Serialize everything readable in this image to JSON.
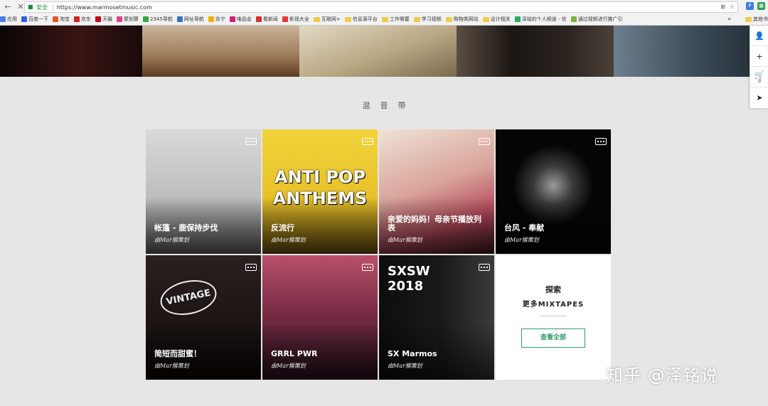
{
  "browser": {
    "back": "←",
    "reload": "✕",
    "secure_label": "安全",
    "url": "https://www.marmosetmusic.com",
    "bookmarks": [
      {
        "label": "应用",
        "color": "#4a7ee0",
        "folder": false
      },
      {
        "label": "百度一下",
        "color": "#2f61d6",
        "folder": false
      },
      {
        "label": "淘宝",
        "color": "#e25822",
        "folder": false
      },
      {
        "label": "京东",
        "color": "#d0261d",
        "folder": false
      },
      {
        "label": "天猫",
        "color": "#c40018",
        "folder": false
      },
      {
        "label": "聚划算",
        "color": "#e04080",
        "folder": false
      },
      {
        "label": "2345导航",
        "color": "#37a83c",
        "folder": false
      },
      {
        "label": "网址导航",
        "color": "#3572c9",
        "folder": false
      },
      {
        "label": "苏宁",
        "color": "#f2b200",
        "folder": false
      },
      {
        "label": "唯品会",
        "color": "#d91e77",
        "folder": false
      },
      {
        "label": "看新闻",
        "color": "#d32f2f",
        "folder": false
      },
      {
        "label": "影视大全",
        "color": "#e53935",
        "folder": false
      },
      {
        "label": "互联网+",
        "color": "",
        "folder": true
      },
      {
        "label": "信息源平台",
        "color": "",
        "folder": true
      },
      {
        "label": "工作需要",
        "color": "",
        "folder": true
      },
      {
        "label": "学习视频",
        "color": "",
        "folder": true
      },
      {
        "label": "购物类网站",
        "color": "",
        "folder": true
      },
      {
        "label": "设计相关",
        "color": "",
        "folder": true
      },
      {
        "label": "泽铭的个人频道 - 优",
        "color": "#27ae60",
        "folder": false
      },
      {
        "label": "通过视频进行推广引",
        "color": "#7cb342",
        "folder": false
      }
    ],
    "more": "»",
    "other_bookmarks": "其他书"
  },
  "hero": {
    "slots": [
      {
        "width": 200,
        "gradient": "linear-gradient(90deg,#0b0606,#3a1414 55%,#1a0a0a)"
      },
      {
        "width": 221,
        "gradient": "linear-gradient(180deg,#c9b49a,#9c7a55 60%,#5b3a24)"
      },
      {
        "width": 221,
        "gradient": "linear-gradient(160deg,#e2d9c4,#b9a783 55%,#7a6a4d)"
      },
      {
        "width": 221,
        "gradient": "linear-gradient(90deg,#5a4e44,#1c1714 35%,#2b2420 70%,#4a4038)"
      },
      {
        "width": 217,
        "gradient": "linear-gradient(90deg,#6d7f8e,#3b4a55 55%,#1f2a33)"
      }
    ]
  },
  "sidebar": {
    "user_icon": "👤",
    "add_user_icon": "+",
    "cart_icon": "🛒",
    "cart_count": "0",
    "send_icon": "➤"
  },
  "section_title": "混音带",
  "tiles": [
    {
      "title": "帐篷 - 鹿保持步伐",
      "by": "由Mar猴策划",
      "art": "linear-gradient(180deg,#d9d9d9,#bdbdbd 55%,#6f6f6f)"
    },
    {
      "title": "反流行",
      "by": "由Mar猴策划",
      "art": "linear-gradient(180deg,#f2d43a,#e8c12a 55%,#7a5f12)",
      "cover_text": "ANTI POP ANTHEMS"
    },
    {
      "title": "亲爱的妈妈！母亲节播放列表",
      "by": "由Mar猴策划",
      "art": "linear-gradient(160deg,#efe2d6,#d9a49a 45%,#b3485a 75%,#4a1f22)"
    },
    {
      "title": "台风 - 奉献",
      "by": "由Mar猴策划",
      "art": "radial-gradient(circle at 50% 45%,#9a9a9a 0,#3a3a3a 22%,#050505 45%)"
    },
    {
      "title": "简短而甜蜜！",
      "by": "由Mar猴策划",
      "art": "linear-gradient(180deg,#2a2020,#1c1512 55%,#0c0807)",
      "cover_text": "VINTAGE"
    },
    {
      "title": "GRRL PWR",
      "by": "由Mar猴策划",
      "art": "linear-gradient(180deg,#b9506a,#7a2c45 45%,#2c1420)"
    },
    {
      "title": "SX Marmos",
      "by": "由Mar猴策划",
      "art": "linear-gradient(90deg,#0d0d0d,#1a1a1a 55%,#3b3b3b)",
      "cover_text": "SXSW 2018"
    }
  ],
  "explore": {
    "line1": "探索",
    "line2": "更多MIXTAPES",
    "button": "查看全部"
  },
  "watermark": "知乎 @泽铭说"
}
